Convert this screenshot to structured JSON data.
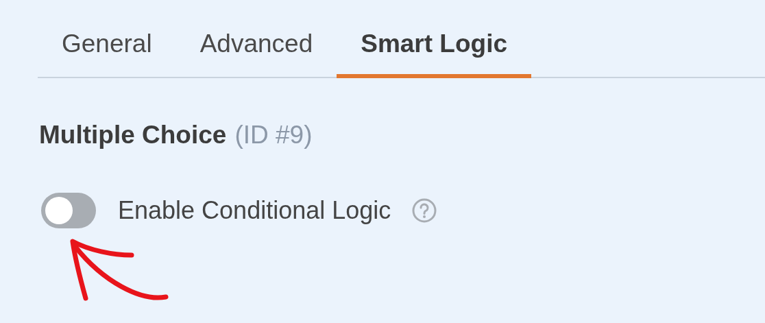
{
  "tabs": [
    {
      "label": "General",
      "selected": false
    },
    {
      "label": "Advanced",
      "selected": false
    },
    {
      "label": "Smart Logic",
      "selected": true
    }
  ],
  "field": {
    "title": "Multiple Choice",
    "id": "(ID #9)"
  },
  "toggle": {
    "label": "Enable Conditional Logic",
    "on": false
  }
}
